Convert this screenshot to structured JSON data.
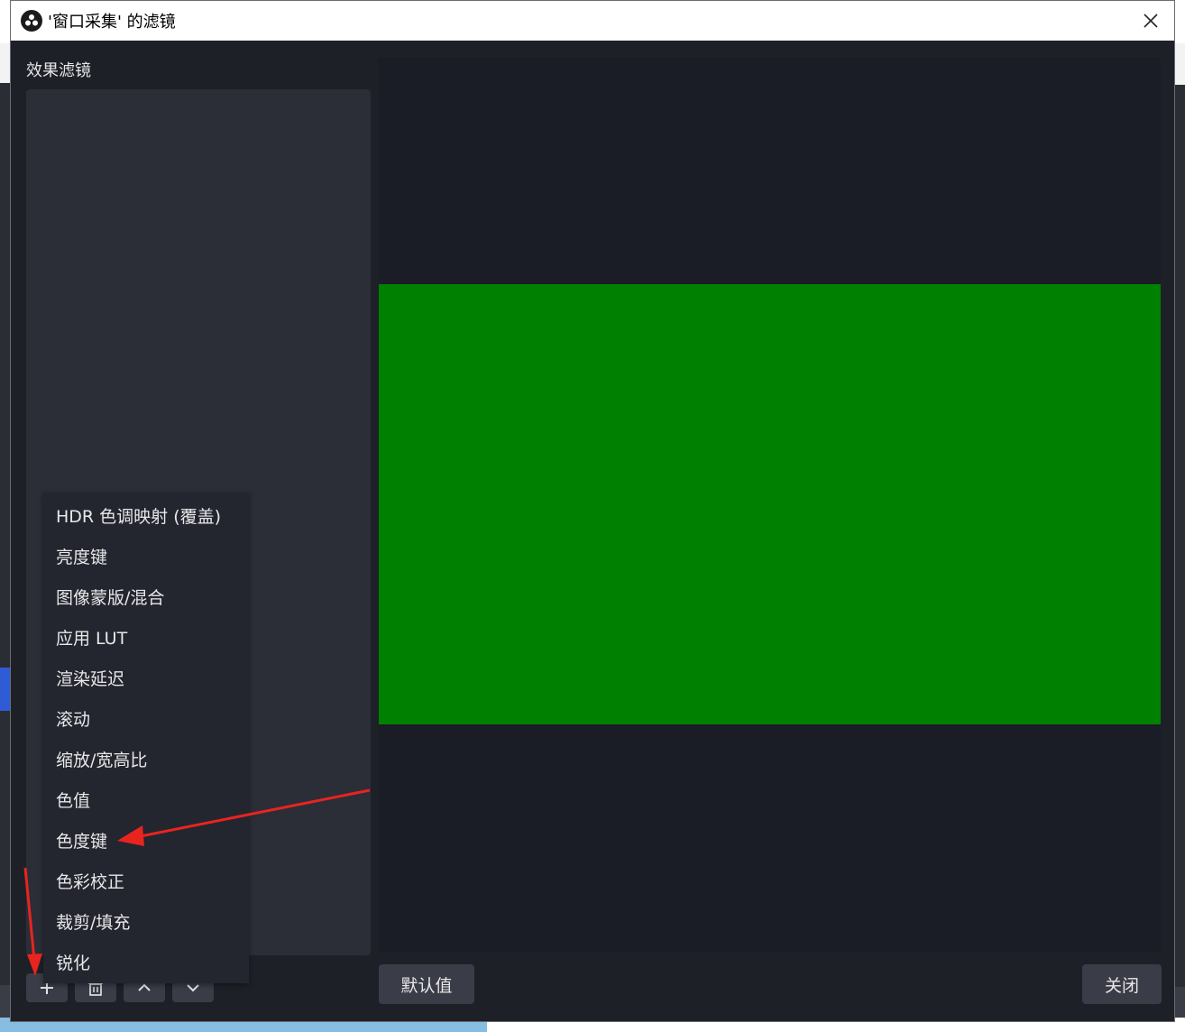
{
  "window": {
    "title": "'窗口采集' 的滤镜",
    "close_glyph": "✕"
  },
  "filters_panel": {
    "label": "效果滤镜"
  },
  "toolbar": {
    "add_glyph": "+",
    "remove_icon": "trash-icon",
    "up_icon": "chevron-up-icon",
    "down_icon": "chevron-down-icon"
  },
  "buttons": {
    "defaults": "默认值",
    "close": "关闭"
  },
  "menu": {
    "items": [
      "HDR 色调映射 (覆盖)",
      "亮度键",
      "图像蒙版/混合",
      "应用 LUT",
      "渲染延迟",
      "滚动",
      "缩放/宽高比",
      "色值",
      "色度键",
      "色彩校正",
      "裁剪/填充",
      "锐化"
    ]
  },
  "colors": {
    "preview_fill": "#008000",
    "annotation_arrow": "#e8241f",
    "dialog_bg": "#1e2028"
  }
}
